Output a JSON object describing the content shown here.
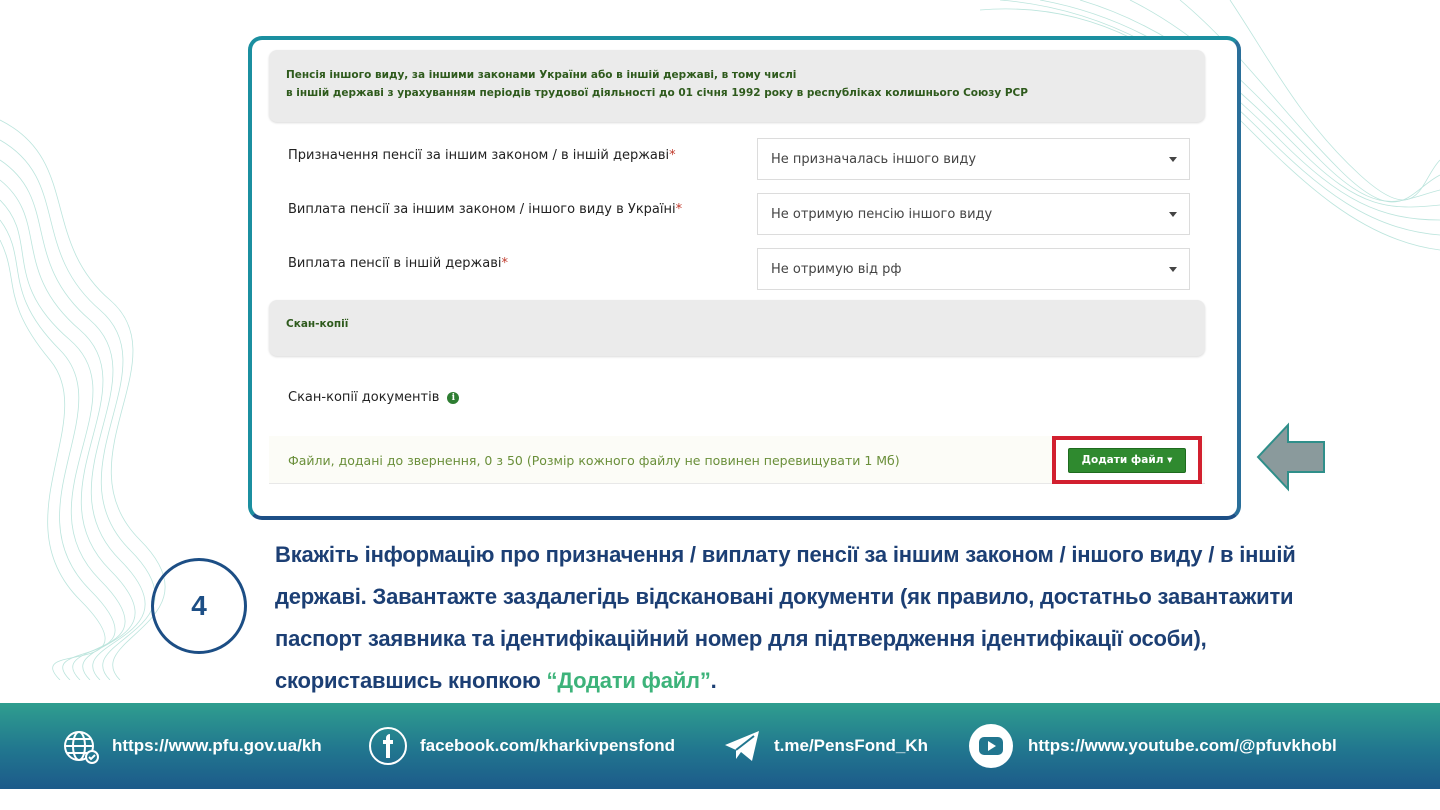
{
  "screenshot": {
    "pension_section_title_line1": "Пенсія іншого виду, за іншими законами України або в іншій державі, в тому числі",
    "pension_section_title_line2": "в іншій державі з урахуванням періодів трудової діяльності до 01 січня 1992 року в республіках колишнього Союзу РСР",
    "rows": [
      {
        "label": "Призначення пенсії за іншим законом / в іншій державі",
        "required": "*",
        "value": "Не призначалась іншого виду"
      },
      {
        "label": "Виплата пенсії за іншим законом / іншого виду в Україні",
        "required": "*",
        "value": "Не отримую пенсію іншого виду"
      },
      {
        "label": "Виплата пенсії в іншій державі",
        "required": "*",
        "value": "Не отримую від рф"
      }
    ],
    "scan_section_title": "Скан-копії",
    "scan_docs_label": "Скан-копії документів",
    "info_icon_glyph": "i",
    "files_info": "Файли, додані до звернення, 0 з 50 (Розмір кожного файлу не повинен перевищувати 1 Мб)",
    "add_file_button": "Додати файл ▾"
  },
  "step": {
    "number": "4",
    "text_before": "Вкажіть інформацію про призначення / виплату пенсії за іншим законом / іншого виду / в іншій державі. Завантажте заздалегідь відскановані документи (як правило, достатньо завантажити паспорт заявника та ідентифікаційний номер для підтвердження ідентифікації особи), скориставшись кнопкою ",
    "highlight": "“Додати файл”",
    "text_after": "."
  },
  "footer": {
    "website": "https://www.pfu.gov.ua/kh",
    "facebook": "facebook.com/kharkivpensfond",
    "telegram": "t.me/PensFond_Kh",
    "youtube": "https://www.youtube.com/@pfuvkhobl"
  },
  "colors": {
    "accent_green": "#3db37a",
    "text_blue": "#1c3f74",
    "highlight_red": "#d2202f",
    "button_green": "#2f8a2f"
  },
  "icons": [
    "globe-icon",
    "facebook-icon",
    "telegram-icon",
    "youtube-icon",
    "info-icon",
    "left-arrow-icon",
    "caret-down-icon"
  ]
}
